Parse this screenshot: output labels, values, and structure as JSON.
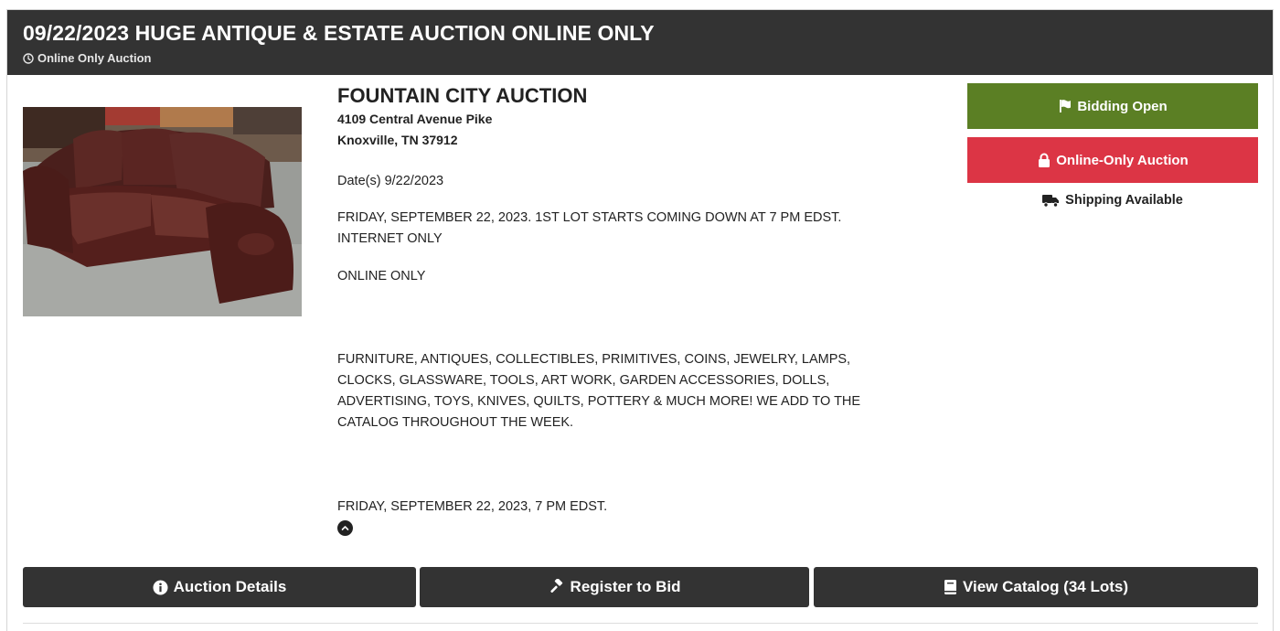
{
  "header": {
    "title": "09/22/2023 HUGE ANTIQUE & ESTATE AUCTION ONLINE ONLY",
    "subtitle": "Online Only Auction",
    "subtitle_icon": "clock-icon"
  },
  "image": {
    "subject": "Leather sofa"
  },
  "auctioneer": {
    "name": "FOUNTAIN CITY AUCTION",
    "address_line1": "4109 Central Avenue Pike",
    "address_line2": "Knoxville, TN 37912"
  },
  "description": {
    "dates": "Date(s) 9/22/2023",
    "line1": "FRIDAY, SEPTEMBER 22, 2023. 1ST LOT STARTS COMING DOWN AT 7 PM EDST. INTERNET ONLY",
    "line2": "ONLINE ONLY",
    "line3": "FURNITURE, ANTIQUES, COLLECTIBLES, PRIMITIVES, COINS, JEWELRY, LAMPS, CLOCKS, GLASSWARE, TOOLS, ART WORK, GARDEN ACCESSORIES, DOLLS, ADVERTISING, TOYS, KNIVES, QUILTS, POTTERY & MUCH MORE! WE ADD TO THE CATALOG THROUGHOUT THE WEEK.",
    "line4": "FRIDAY, SEPTEMBER 22, 2023, 7 PM EDST."
  },
  "status": {
    "bidding_label": "Bidding Open",
    "bidding_icon": "flag-icon",
    "bidding_color": "#5b7f24",
    "type_label": "Online-Only Auction",
    "type_icon": "lock-icon",
    "type_color": "#dc3545",
    "shipping_label": "Shipping Available",
    "shipping_icon": "truck-icon"
  },
  "actions": {
    "details_label": "Auction Details",
    "details_icon": "info-circle-icon",
    "register_label": "Register to Bid",
    "register_icon": "gavel-icon",
    "catalog_label": "View Catalog (34 Lots)",
    "catalog_icon": "book-icon"
  },
  "colors": {
    "header_bg": "#333333",
    "button_bg": "#333333"
  }
}
